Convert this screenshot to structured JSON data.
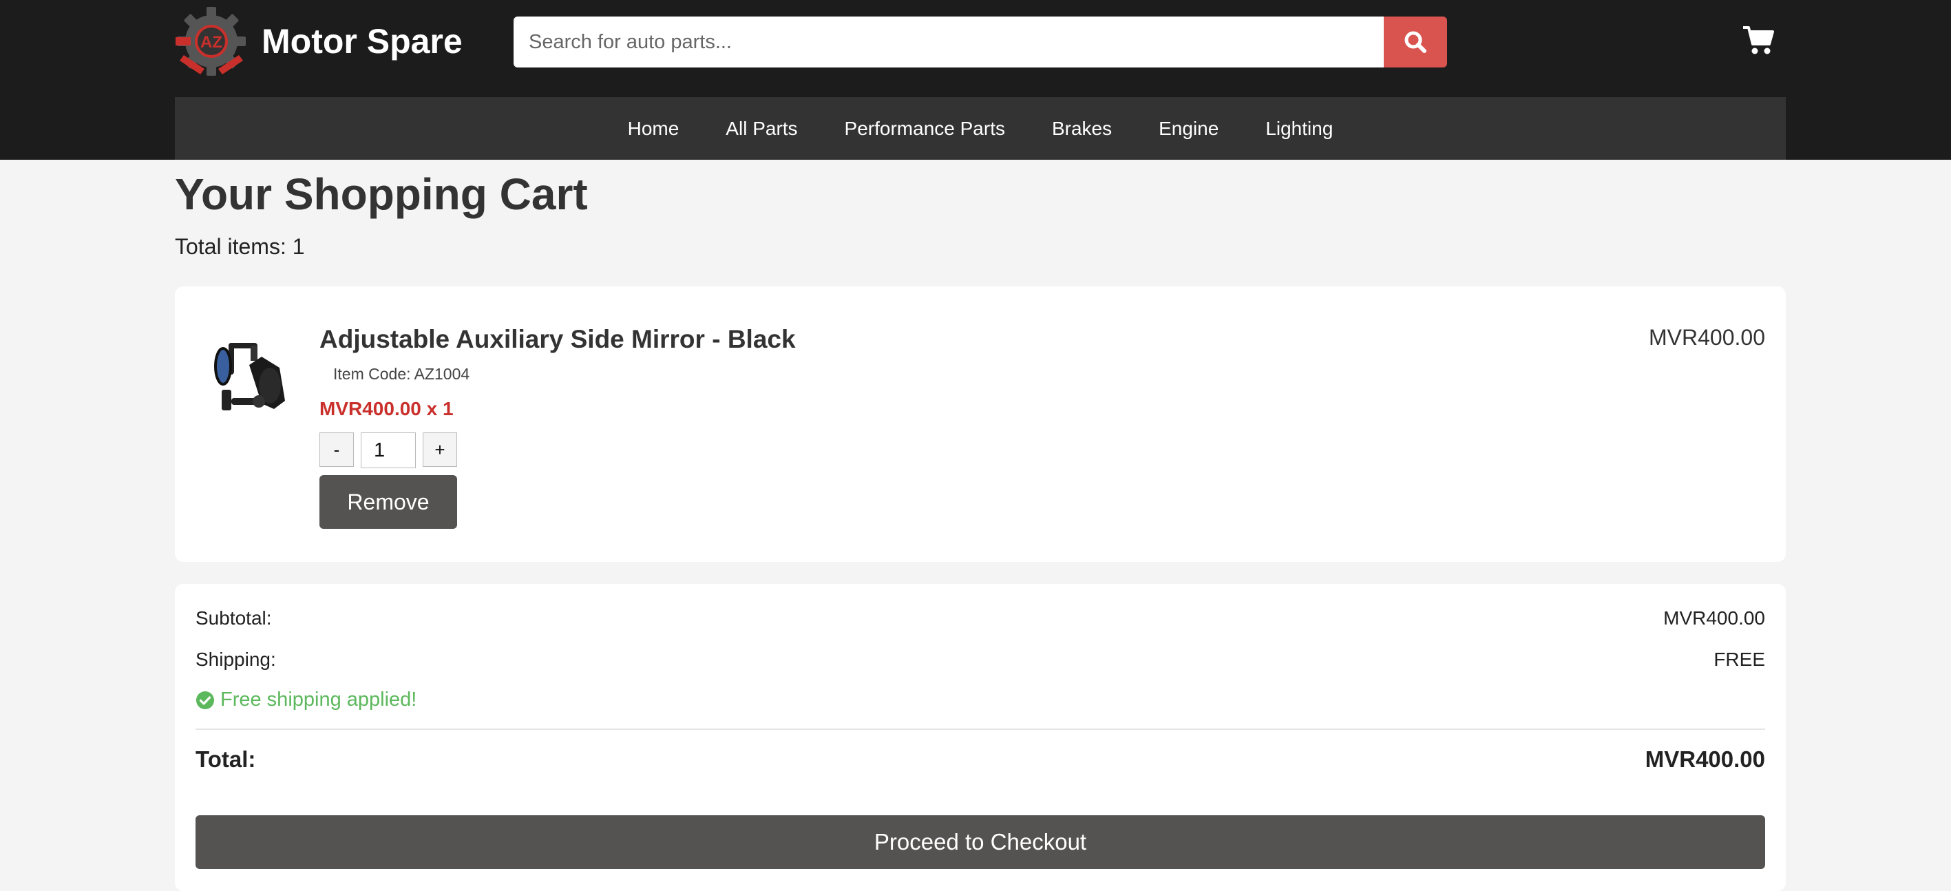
{
  "header": {
    "brand_name": "Motor Spare",
    "logo_text": "AZ",
    "search_placeholder": "Search for auto parts...",
    "search_value": "",
    "accent_color": "#d9534f",
    "logo_icon": "gear-wrench-logo-icon",
    "search_icon": "search-icon",
    "cart_icon": "cart-icon"
  },
  "nav": {
    "items": [
      "Home",
      "All Parts",
      "Performance Parts",
      "Brakes",
      "Engine",
      "Lighting"
    ]
  },
  "cart": {
    "title": "Your Shopping Cart",
    "total_items": "Total items: 1",
    "items": [
      {
        "name": "Adjustable Auxiliary Side Mirror - Black",
        "item_code": "Item Code: AZ1004",
        "unit_line": "MVR400.00 x 1",
        "quantity": "1",
        "line_total": "MVR400.00",
        "minus_label": "-",
        "plus_label": "+",
        "remove_label": "Remove",
        "image_icon": "side-mirror-product-image"
      }
    ]
  },
  "summary": {
    "subtotal_label": "Subtotal:",
    "subtotal_value": "MVR400.00",
    "shipping_label": "Shipping:",
    "shipping_value": "FREE",
    "free_shipping_note": "Free shipping applied!",
    "check_icon": "check-circle-icon",
    "success_color": "#5cb85c",
    "total_label": "Total:",
    "total_value": "MVR400.00",
    "checkout_label": "Proceed to Checkout"
  }
}
